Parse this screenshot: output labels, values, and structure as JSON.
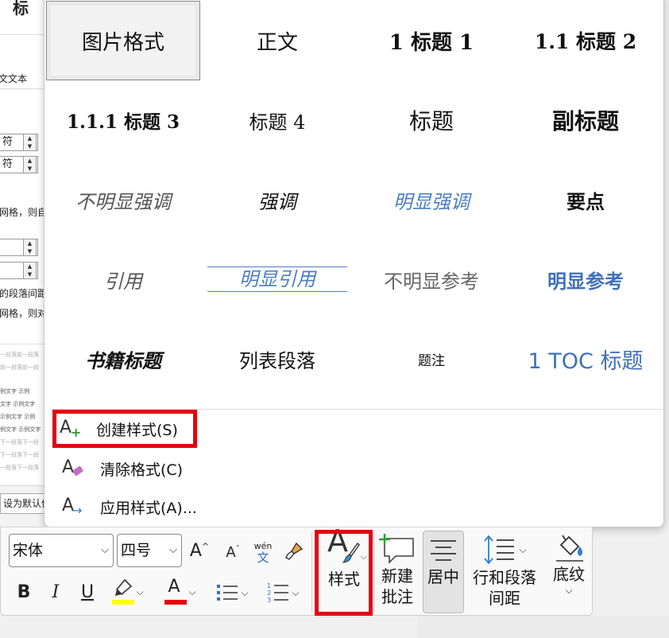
{
  "background_dialog": {
    "title_partial": "标",
    "line1_partial": "文文本",
    "field1": "符",
    "field2": "符",
    "note1_partial": "网格，则自",
    "field3": "",
    "field4": "",
    "note2_partial": "的段落间距",
    "note3_partial": "网格，则对",
    "preview_lines": [
      "一段落前一段落",
      "前一段落前一段",
      "例文字 示例",
      "文字 示例文字",
      "示例文字 示例",
      "例文字 示例文字",
      "下一段落下一段",
      "下一段落下一段",
      "一段落下一段落"
    ],
    "default_button_partial": "设为默认值"
  },
  "style_gallery": {
    "styles": [
      {
        "label": "图片格式"
      },
      {
        "label": "正文"
      },
      {
        "label": "1  标题 1"
      },
      {
        "label": "1.1  标题 2"
      },
      {
        "label": "1.1.1  标题 3"
      },
      {
        "label": "标题 4"
      },
      {
        "label": "标题"
      },
      {
        "label": "副标题"
      },
      {
        "label": "不明显强调"
      },
      {
        "label": "强调"
      },
      {
        "label": "明显强调"
      },
      {
        "label": "要点"
      },
      {
        "label": "引用"
      },
      {
        "label": "明显引用"
      },
      {
        "label": "不明显参考"
      },
      {
        "label": "明显参考"
      },
      {
        "label": "书籍标题"
      },
      {
        "label": "列表段落"
      },
      {
        "label": "题注"
      },
      {
        "label": "1  TOC 标题"
      }
    ],
    "menu": {
      "create_style": "创建样式(S)",
      "clear_format": "清除格式(C)",
      "apply_style": "应用样式(A)..."
    }
  },
  "ribbon": {
    "font_name": "宋体",
    "font_size": "四号",
    "phonetic_label": "wén",
    "phonetic_char": "文",
    "styles_button": "样式",
    "new_comment_line1": "新建",
    "new_comment_line2": "批注",
    "center_button": "居中",
    "spacing_line1": "行和段落",
    "spacing_line2": "间距",
    "shading_button": "底纹"
  },
  "colors": {
    "highlight_red": "#e6000f",
    "link_blue": "#2f6fcf",
    "highlight_yellow": "#ffff00",
    "font_color_red": "#e3000f"
  }
}
